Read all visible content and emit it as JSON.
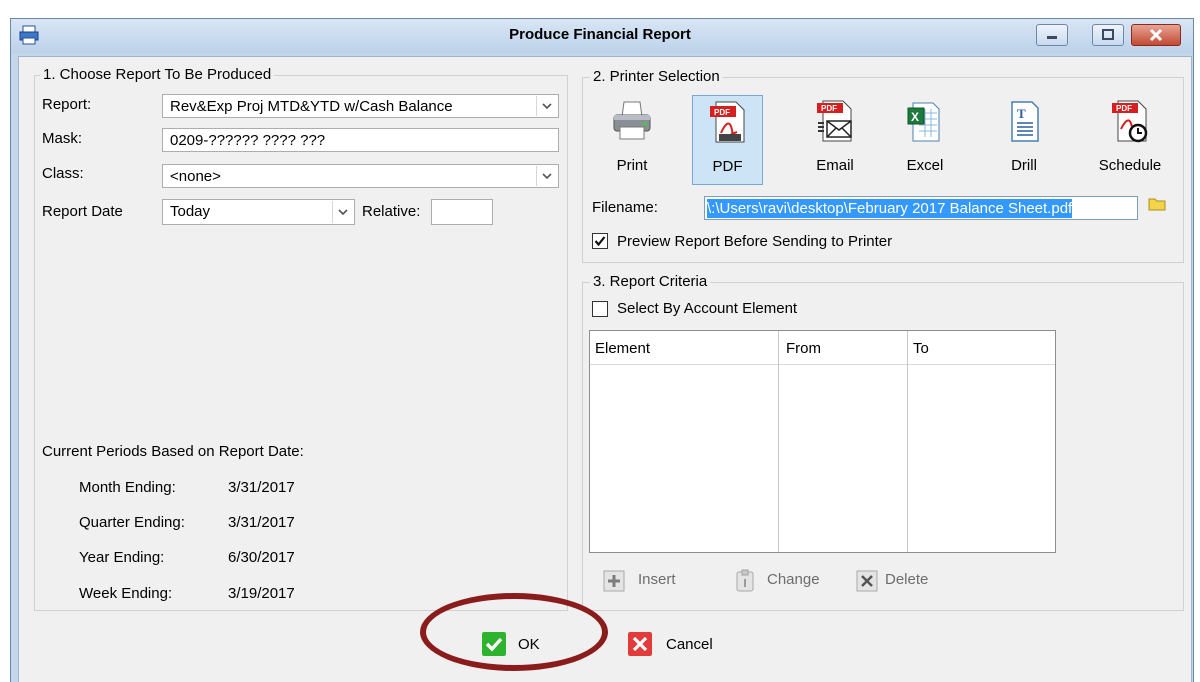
{
  "window": {
    "title": "Produce Financial Report",
    "minimize_icon": "minimize-icon",
    "maximize_icon": "maximize-icon",
    "close_icon": "close-icon"
  },
  "choose_report": {
    "group_label": "1. Choose Report To Be Produced",
    "report_label": "Report:",
    "report_value": "Rev&Exp Proj MTD&YTD w/Cash Balance",
    "mask_label": "Mask:",
    "mask_value": "0209-?????? ???? ???",
    "class_label": "Class:",
    "class_value": "<none>",
    "report_date_label": "Report Date",
    "report_date_value": "Today",
    "relative_label": "Relative:",
    "relative_value": "",
    "periods_heading": "Current Periods Based on Report Date:",
    "periods": [
      {
        "label": "Month Ending:",
        "value": "3/31/2017"
      },
      {
        "label": "Quarter Ending:",
        "value": "3/31/2017"
      },
      {
        "label": "Year Ending:",
        "value": "6/30/2017"
      },
      {
        "label": "Week Ending:",
        "value": "3/19/2017"
      }
    ]
  },
  "printer_selection": {
    "group_label": "2. Printer Selection",
    "options": [
      {
        "label": "Print",
        "icon": "printer-icon",
        "selected": false
      },
      {
        "label": "PDF",
        "icon": "pdf-icon",
        "selected": true
      },
      {
        "label": "Email",
        "icon": "pdf-email-icon",
        "selected": false
      },
      {
        "label": "Excel",
        "icon": "excel-icon",
        "selected": false
      },
      {
        "label": "Drill",
        "icon": "text-document-icon",
        "selected": false
      },
      {
        "label": "Schedule",
        "icon": "pdf-schedule-icon",
        "selected": false
      }
    ],
    "filename_label": "Filename:",
    "filename_value": "\\:\\Users\\ravi\\desktop\\February 2017 Balance Sheet.pdf",
    "preview_label": "Preview Report Before Sending to Printer",
    "preview_checked": true
  },
  "report_criteria": {
    "group_label": "3. Report Criteria",
    "select_by_label": "Select By Account Element",
    "select_by_checked": false,
    "columns": [
      "Element",
      "From",
      "To"
    ],
    "rows": [],
    "insert_label": "Insert",
    "change_label": "Change",
    "delete_label": "Delete"
  },
  "footer": {
    "ok_label": "OK",
    "cancel_label": "Cancel"
  },
  "colors": {
    "selection_blue": "#3399ff",
    "ok_green": "#2db32d",
    "cancel_red": "#e23b3b",
    "highlight_oval": "#8b1c1c"
  }
}
